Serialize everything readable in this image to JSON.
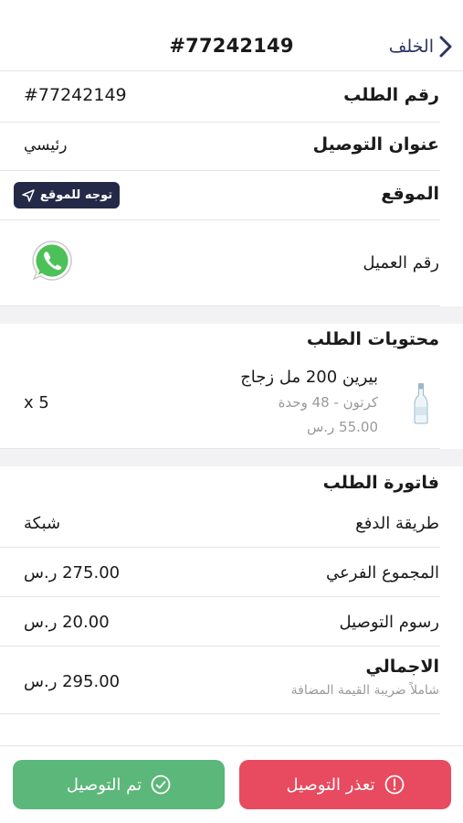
{
  "header": {
    "order_title": "#77242149",
    "back_label": "الخلف"
  },
  "details": {
    "order_number_label": "رقم الطلب",
    "order_number_value": "#77242149",
    "address_label": "عنوان التوصيل",
    "address_value": "رئيسي",
    "location_label": "الموقع",
    "navigate_button": "توجه للموقع",
    "customer_number_label": "رقم العميل"
  },
  "contents": {
    "title": "محتويات الطلب",
    "items": [
      {
        "name": "بيرين 200 مل زجاج",
        "unit": "كرتون - 48 وحدة",
        "price": "55.00 ر.س",
        "quantity": "x 5"
      }
    ]
  },
  "invoice": {
    "title": "فاتورة الطلب",
    "payment_method_label": "طريقة الدفع",
    "payment_method_value": "شبكة",
    "subtotal_label": "المجموع الفرعي",
    "subtotal_value": "275.00 ر.س",
    "delivery_fee_label": "رسوم التوصيل",
    "delivery_fee_value": "20.00 ر.س",
    "total_label": "الاجمالي",
    "total_note": "شاملاً ضريبة القيمة المضافة",
    "total_value": "295.00 ر.س"
  },
  "actions": {
    "fail_label": "تعذر التوصيل",
    "done_label": "تم التوصيل"
  },
  "colors": {
    "nav_button_bg": "#232946",
    "fail_button_bg": "#e84a5f",
    "done_button_bg": "#5cb77a",
    "whatsapp": "#4cc157"
  },
  "icons": {
    "back": "chevron-right-icon",
    "navigate": "navigation-arrow-icon",
    "whatsapp": "whatsapp-icon",
    "alert": "exclamation-circle-icon",
    "check": "check-circle-icon"
  }
}
